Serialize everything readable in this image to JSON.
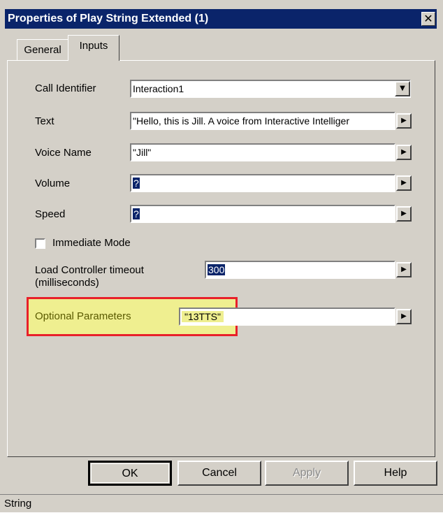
{
  "window": {
    "title": "Properties of Play String Extended (1)",
    "close_glyph": "✕"
  },
  "tabs": [
    {
      "label": "General"
    },
    {
      "label": "Inputs"
    }
  ],
  "fields": {
    "call_identifier": {
      "label": "Call Identifier",
      "value": "Interaction1",
      "arrow": "▼"
    },
    "text": {
      "label": "Text",
      "value": "\"Hello, this is Jill. A voice from Interactive Intelliger",
      "arrow": "▶"
    },
    "voice_name": {
      "label": "Voice Name",
      "value": "\"Jill\"",
      "arrow": "▶"
    },
    "volume": {
      "label": "Volume",
      "value": "?",
      "arrow": "▶"
    },
    "speed": {
      "label": "Speed",
      "value": "?",
      "arrow": "▶"
    },
    "immediate_mode": {
      "label": "Immediate Mode",
      "checked": false
    },
    "load_timeout": {
      "label_line1": "Load Controller timeout",
      "label_line2": "(milliseconds)",
      "value": "300",
      "arrow": "▶"
    },
    "optional_params": {
      "label": "Optional Parameters",
      "value": "\"13TTS\"",
      "arrow": "▶"
    }
  },
  "buttons": {
    "ok": "OK",
    "cancel": "Cancel",
    "apply": "Apply",
    "help": "Help"
  },
  "status": {
    "text": "String"
  },
  "colors": {
    "title_bar": "#0a246a",
    "highlight_fill": "#efef90",
    "highlight_border": "#e8202a"
  }
}
